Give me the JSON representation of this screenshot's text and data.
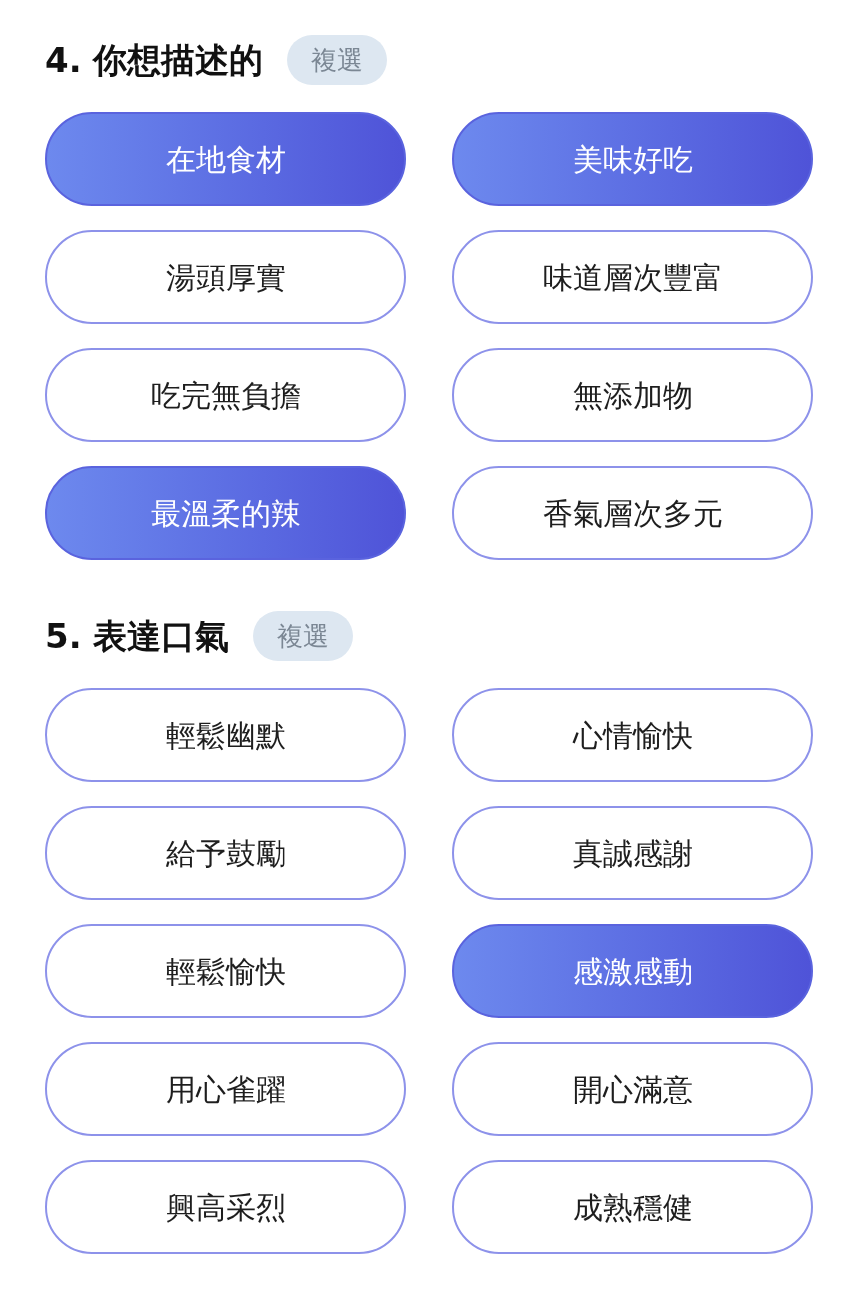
{
  "sections": [
    {
      "title": "4. 你想描述的",
      "badge": "複選",
      "options": [
        {
          "label": "在地食材",
          "selected": true
        },
        {
          "label": "美味好吃",
          "selected": true
        },
        {
          "label": "湯頭厚實",
          "selected": false
        },
        {
          "label": "味道層次豐富",
          "selected": false
        },
        {
          "label": "吃完無負擔",
          "selected": false
        },
        {
          "label": "無添加物",
          "selected": false
        },
        {
          "label": "最溫柔的辣",
          "selected": true
        },
        {
          "label": "香氣層次多元",
          "selected": false
        }
      ]
    },
    {
      "title": "5. 表達口氣",
      "badge": "複選",
      "options": [
        {
          "label": "輕鬆幽默",
          "selected": false
        },
        {
          "label": "心情愉快",
          "selected": false
        },
        {
          "label": "給予鼓勵",
          "selected": false
        },
        {
          "label": "真誠感謝",
          "selected": false
        },
        {
          "label": "輕鬆愉快",
          "selected": false
        },
        {
          "label": "感激感動",
          "selected": true
        },
        {
          "label": "用心雀躍",
          "selected": false
        },
        {
          "label": "開心滿意",
          "selected": false
        },
        {
          "label": "興高采烈",
          "selected": false
        },
        {
          "label": "成熟穩健",
          "selected": false
        }
      ]
    }
  ]
}
